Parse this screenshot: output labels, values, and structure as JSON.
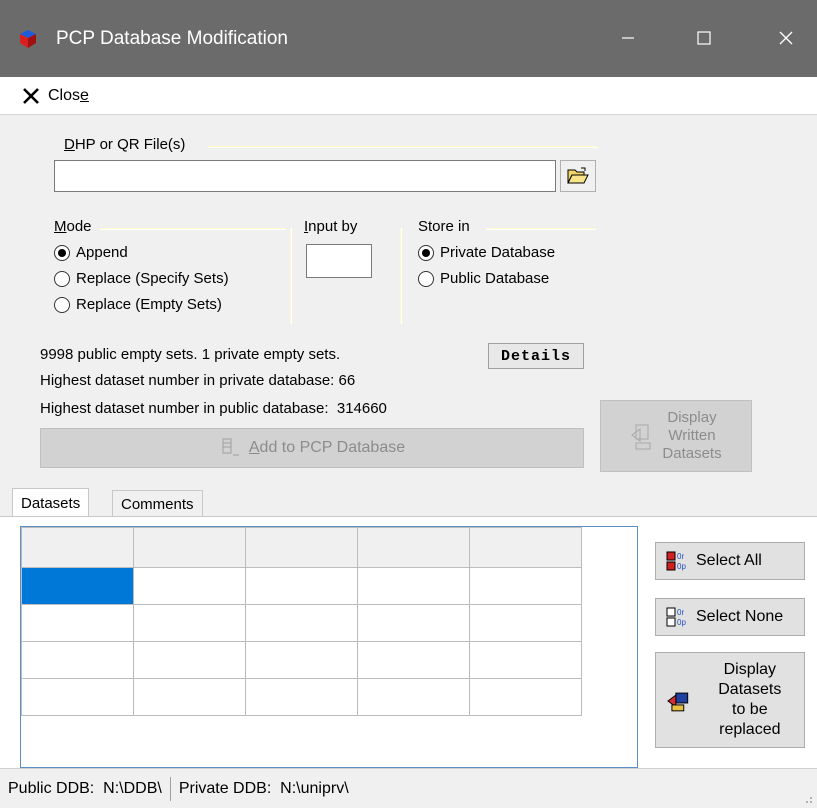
{
  "window": {
    "title": "PCP Database Modification"
  },
  "menu": {
    "close_pre": "Clos",
    "close_ul": "e"
  },
  "file_group": {
    "label_ul": "D",
    "label_rest": "HP or QR File(s)",
    "input_value": ""
  },
  "mode_group": {
    "label_ul": "M",
    "label_rest": "ode",
    "options": [
      {
        "label": "Append",
        "checked": true
      },
      {
        "label": "Replace (Specify Sets)",
        "checked": false
      },
      {
        "label": "Replace (Empty Sets)",
        "checked": false
      }
    ]
  },
  "inputby_group": {
    "label_ul": "I",
    "label_rest": "nput by",
    "value": ""
  },
  "store_group": {
    "label": "Store in",
    "options": [
      {
        "label": "Private Database",
        "checked": true
      },
      {
        "label": "Public Database",
        "checked": false
      }
    ]
  },
  "info": {
    "empty_sets": "9998 public empty sets. 1 private empty sets.",
    "private_highest": "Highest dataset number in private database: 66",
    "public_highest": "Highest dataset number in public database:  314660"
  },
  "buttons": {
    "details": "Details",
    "add_ul": "A",
    "add_rest": "dd to PCP Database",
    "display_written": [
      "Display",
      "Written",
      "Datasets"
    ],
    "select_all": "Select All",
    "select_none": "Select None",
    "display_replaced": [
      "Display",
      "Datasets",
      "to be",
      "replaced"
    ]
  },
  "tabs": [
    {
      "label": "Datasets",
      "active": true
    },
    {
      "label": "Comments",
      "active": false
    }
  ],
  "grid": {
    "columns": 5,
    "rows": 4,
    "selected_cell": [
      0,
      0
    ]
  },
  "status": {
    "public": "Public DDB:  N:\\DDB\\",
    "private": "Private DDB:  N:\\uniprv\\"
  },
  "colors": {
    "titlebar": "#6b6b6b",
    "selection": "#0078d7",
    "grid_border": "#5c8ec8"
  }
}
